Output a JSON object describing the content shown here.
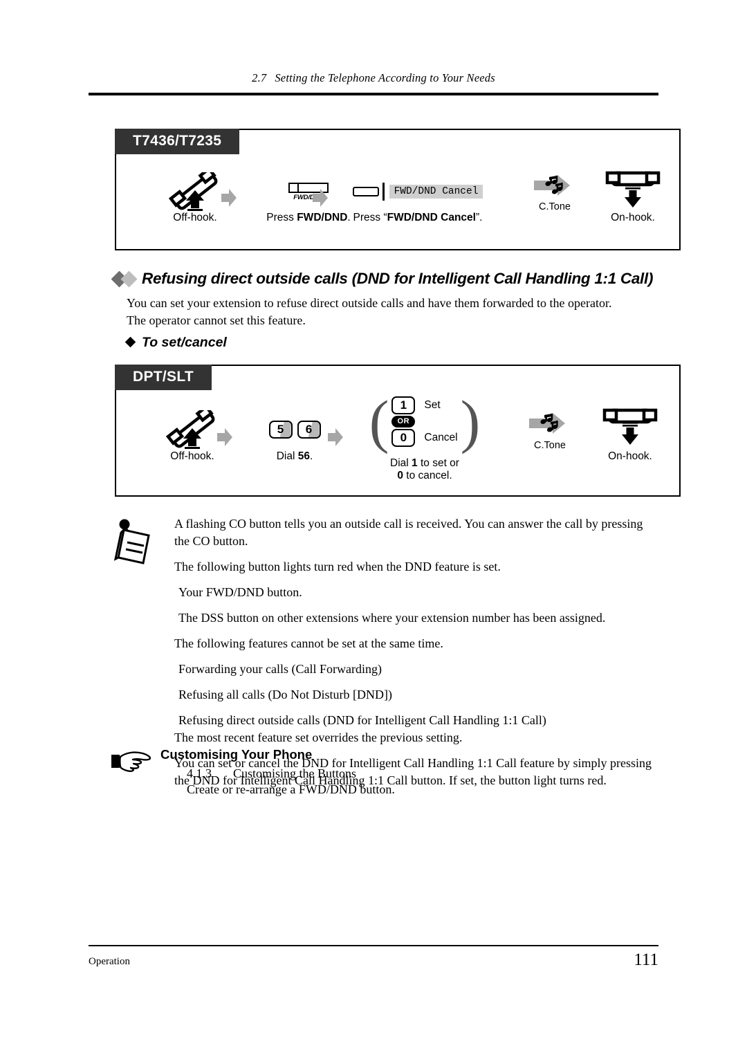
{
  "header": {
    "section_number": "2.7",
    "section_title": "Setting the Telephone According to Your Needs"
  },
  "footer": {
    "left": "Operation",
    "page_number": "111"
  },
  "box1": {
    "tag": "T7436/T7235",
    "steps": [
      {
        "icon": "handset-offhook-icon",
        "caption": "Off-hook."
      },
      {
        "icon": "fwd-dnd-button-icon",
        "button_label": "FWD/DND",
        "caption_prefix": "Press ",
        "caption_bold": "FWD/DND",
        "caption_suffix": "."
      },
      {
        "icon": "softkey-lcd-icon",
        "lcd_text": "FWD/DND Cancel",
        "caption_prefix": "Press “",
        "caption_bold": "FWD/DND Cancel",
        "caption_suffix": "”."
      },
      {
        "icon": "confirmation-tone-icon",
        "sublabel": "C.Tone"
      },
      {
        "icon": "handset-onhook-icon",
        "caption": "On-hook."
      }
    ]
  },
  "feature": {
    "title": "Refusing direct outside calls (DND for Intelligent Call Handling 1:1 Call)",
    "body_line1": "You can set your extension to refuse direct outside calls and have them forwarded to the operator.",
    "body_line2": "The operator cannot set this feature.",
    "subheading": "To set/cancel"
  },
  "box2": {
    "tag": "DPT/SLT",
    "steps": [
      {
        "icon": "handset-offhook-icon",
        "caption": "Off-hook."
      },
      {
        "icon": "dial-keys-icon",
        "keys": [
          "5",
          "6"
        ],
        "caption_prefix": "Dial ",
        "caption_bold": "56",
        "caption_suffix": "."
      },
      {
        "icon": "set-cancel-choice-icon",
        "key_set": "1",
        "label_set": "Set",
        "or_label": "OR",
        "key_cancel": "0",
        "label_cancel": "Cancel",
        "caption_line1_a": "Dial ",
        "caption_line1_b": "1",
        "caption_line1_c": " to set or",
        "caption_line2_a": "0",
        "caption_line2_b": " to cancel."
      },
      {
        "icon": "confirmation-tone-icon",
        "sublabel": "C.Tone"
      },
      {
        "icon": "handset-onhook-icon",
        "caption": "On-hook."
      }
    ]
  },
  "notes": {
    "icon": "note-pad-icon",
    "items": [
      "A flashing CO button tells you an outside call is received. You can answer the call by pressing the CO button.",
      "The following button lights turn red when the DND feature is set.",
      "Your FWD/DND button.",
      "The DSS button on other extensions where your extension number has been assigned.",
      "The following features cannot be set at the same time.",
      "Forwarding your calls (Call Forwarding)",
      "Refusing all calls (Do Not Disturb [DND])",
      "Refusing direct outside calls (DND for Intelligent Call Handling 1:1 Call)",
      "The most recent feature set overrides the previous setting.",
      "You can set or cancel the DND for Intelligent Call Handling 1:1 Call feature by simply pressing the DND for Intelligent Call Handling 1:1 Call button. If set, the button light turns red."
    ]
  },
  "customising": {
    "icon": "pointing-hand-icon",
    "title": "Customising Your Phone",
    "ref_number": "4.1.3",
    "ref_title": "Customising the Buttons",
    "ref_desc": "Create or re-arrange a FWD/DND button."
  },
  "colors": {
    "tag_background": "#333333",
    "arrow_gray": "#a6a6a6",
    "lcd_gray": "#cfcfcf",
    "key_shade": "#b8b8b8",
    "diamond_dark": "#6e6e6e",
    "diamond_light": "#bdbdbd"
  }
}
